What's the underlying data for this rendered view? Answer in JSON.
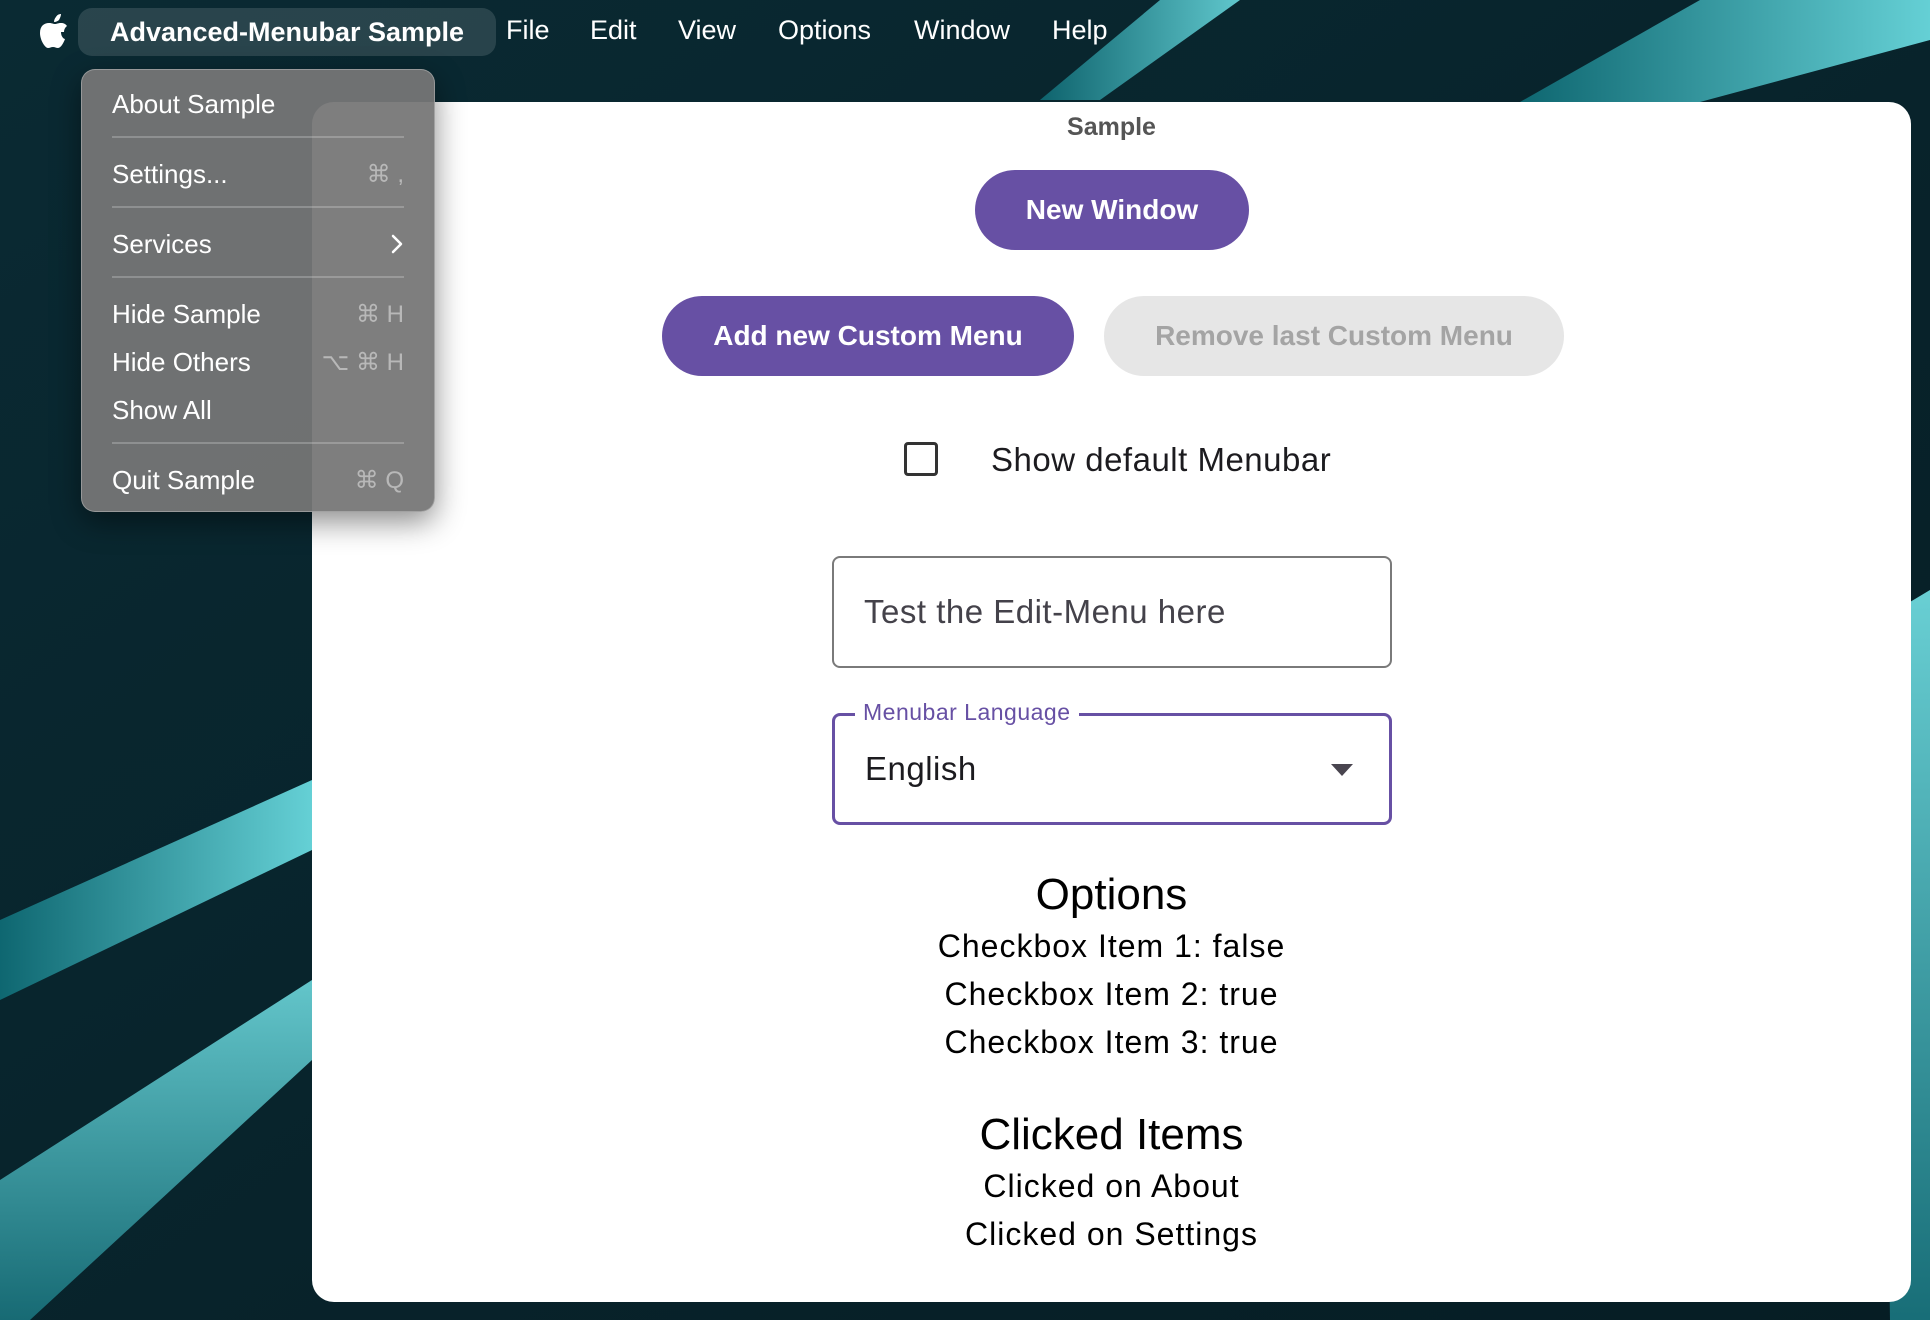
{
  "menubar": {
    "app_name": "Advanced-Menubar Sample",
    "items": [
      "File",
      "Edit",
      "View",
      "Options",
      "Window",
      "Help"
    ]
  },
  "app_menu": {
    "items": [
      {
        "label": "About Sample",
        "shortcut": ""
      },
      {
        "label": "Settings...",
        "shortcut": "⌘ ,"
      },
      {
        "label": "Services",
        "shortcut": ""
      },
      {
        "label": "Hide Sample",
        "shortcut": "⌘ H"
      },
      {
        "label": "Hide Others",
        "shortcut": "⌥ ⌘ H"
      },
      {
        "label": "Show All",
        "shortcut": ""
      },
      {
        "label": "Quit Sample",
        "shortcut": "⌘ Q"
      }
    ]
  },
  "window": {
    "title": "Sample",
    "new_window_label": "New Window",
    "add_menu_label": "Add new Custom Menu",
    "remove_menu_label": "Remove last Custom Menu",
    "show_default_menubar_label": "Show default Menubar",
    "show_default_menubar_checked": false,
    "edit_field_placeholder": "Test the Edit-Menu here",
    "edit_field_value": "",
    "language_label": "Menubar Language",
    "language_value": "English",
    "options_title": "Options",
    "options_lines": [
      "Checkbox Item 1: false",
      "Checkbox Item 2: true",
      "Checkbox Item 3: true"
    ],
    "clicked_title": "Clicked Items",
    "clicked_lines": [
      "Clicked on About",
      "Clicked on Settings"
    ]
  },
  "colors": {
    "accent": "#6750a4",
    "disabled_bg": "#e6e6e6",
    "disabled_text": "#a4a4a4"
  }
}
